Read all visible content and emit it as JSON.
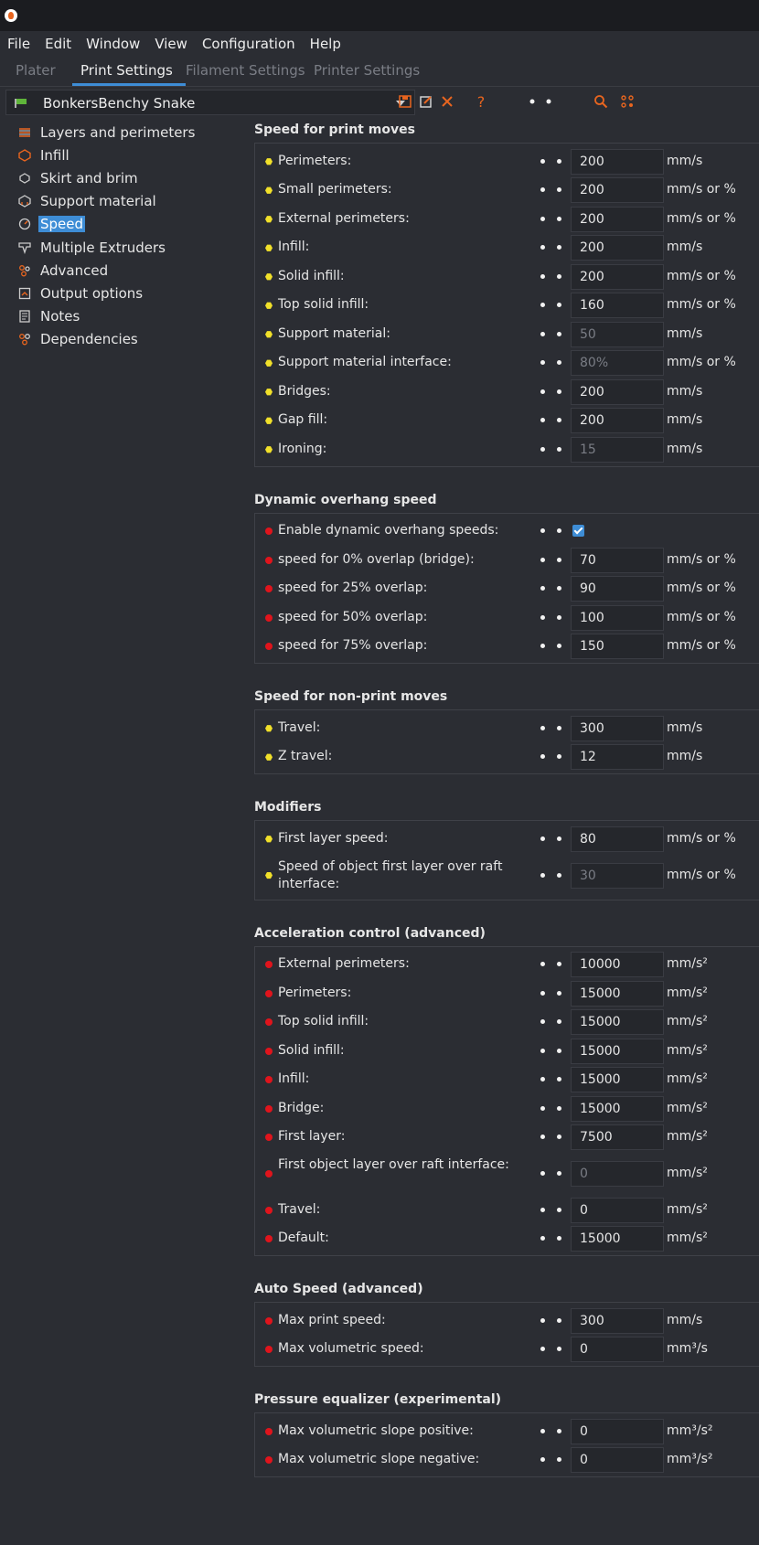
{
  "menu": [
    "File",
    "Edit",
    "Window",
    "View",
    "Configuration",
    "Help"
  ],
  "tabs": [
    "Plater",
    "Print Settings",
    "Filament Settings",
    "Printer Settings"
  ],
  "preset": {
    "name": "BonkersBenchy Snake"
  },
  "toolbar_icons": [
    "save-icon",
    "edit-icon",
    "delete-icon",
    "help-icon",
    "compare-icon",
    "search-icon",
    "options-icon"
  ],
  "toolbar_glyphs": {
    "help": "?"
  },
  "sidebar": [
    {
      "label": "Layers and perimeters",
      "icon": "layers-icon"
    },
    {
      "label": "Infill",
      "icon": "infill-icon"
    },
    {
      "label": "Skirt and brim",
      "icon": "skirt-icon"
    },
    {
      "label": "Support material",
      "icon": "support-icon"
    },
    {
      "label": "Speed",
      "icon": "speed-icon",
      "active": true
    },
    {
      "label": "Multiple Extruders",
      "icon": "extruder-icon"
    },
    {
      "label": "Advanced",
      "icon": "advanced-icon"
    },
    {
      "label": "Output options",
      "icon": "output-icon"
    },
    {
      "label": "Notes",
      "icon": "notes-icon"
    },
    {
      "label": "Dependencies",
      "icon": "dependencies-icon"
    }
  ],
  "colors": {
    "accent": "#3e8dd6",
    "bullet_yellow": "#f1e02a",
    "bullet_red": "#e0141c",
    "orange_icon": "#e8651f"
  },
  "sections": [
    {
      "title": "Speed for print moves",
      "rows": [
        {
          "label": "Perimeters:",
          "value": "200",
          "unit": "mm/s",
          "bullet": "yellow"
        },
        {
          "label": "Small perimeters:",
          "value": "200",
          "unit": "mm/s or %",
          "bullet": "yellow"
        },
        {
          "label": "External perimeters:",
          "value": "200",
          "unit": "mm/s or %",
          "bullet": "yellow"
        },
        {
          "label": "Infill:",
          "value": "200",
          "unit": "mm/s",
          "bullet": "yellow"
        },
        {
          "label": "Solid infill:",
          "value": "200",
          "unit": "mm/s or %",
          "bullet": "yellow"
        },
        {
          "label": "Top solid infill:",
          "value": "160",
          "unit": "mm/s or %",
          "bullet": "yellow"
        },
        {
          "label": "Support material:",
          "value": "50",
          "unit": "mm/s",
          "bullet": "yellow",
          "disabled": true
        },
        {
          "label": "Support material interface:",
          "value": "80%",
          "unit": "mm/s or %",
          "bullet": "yellow",
          "disabled": true
        },
        {
          "label": "Bridges:",
          "value": "200",
          "unit": "mm/s",
          "bullet": "yellow"
        },
        {
          "label": "Gap fill:",
          "value": "200",
          "unit": "mm/s",
          "bullet": "yellow"
        },
        {
          "label": "Ironing:",
          "value": "15",
          "unit": "mm/s",
          "bullet": "yellow",
          "disabled": true
        }
      ]
    },
    {
      "title": "Dynamic overhang speed",
      "rows": [
        {
          "label": "Enable dynamic overhang speeds:",
          "checkbox": true,
          "checked": true,
          "bullet": "red"
        },
        {
          "label": "speed for 0% overlap (bridge):",
          "value": "70",
          "unit": "mm/s or %",
          "bullet": "red"
        },
        {
          "label": "speed for 25% overlap:",
          "value": "90",
          "unit": "mm/s or %",
          "bullet": "red"
        },
        {
          "label": "speed for 50% overlap:",
          "value": "100",
          "unit": "mm/s or %",
          "bullet": "red"
        },
        {
          "label": "speed for 75% overlap:",
          "value": "150",
          "unit": "mm/s or %",
          "bullet": "red"
        }
      ]
    },
    {
      "title": "Speed for non-print moves",
      "rows": [
        {
          "label": "Travel:",
          "value": "300",
          "unit": "mm/s",
          "bullet": "yellow"
        },
        {
          "label": "Z travel:",
          "value": "12",
          "unit": "mm/s",
          "bullet": "yellow"
        }
      ]
    },
    {
      "title": "Modifiers",
      "rows": [
        {
          "label": "First layer speed:",
          "value": "80",
          "unit": "mm/s or %",
          "bullet": "yellow"
        },
        {
          "label": "Speed of object first layer over raft interface:",
          "value": "30",
          "unit": "mm/s or %",
          "bullet": "yellow",
          "disabled": true,
          "tall": true
        }
      ]
    },
    {
      "title": "Acceleration control (advanced)",
      "rows": [
        {
          "label": "External perimeters:",
          "value": "10000",
          "unit": "mm/s²",
          "bullet": "red"
        },
        {
          "label": "Perimeters:",
          "value": "15000",
          "unit": "mm/s²",
          "bullet": "red"
        },
        {
          "label": "Top solid infill:",
          "value": "15000",
          "unit": "mm/s²",
          "bullet": "red"
        },
        {
          "label": "Solid infill:",
          "value": "15000",
          "unit": "mm/s²",
          "bullet": "red"
        },
        {
          "label": "Infill:",
          "value": "15000",
          "unit": "mm/s²",
          "bullet": "red"
        },
        {
          "label": "Bridge:",
          "value": "15000",
          "unit": "mm/s²",
          "bullet": "red"
        },
        {
          "label": "First layer:",
          "value": "7500",
          "unit": "mm/s²",
          "bullet": "red"
        },
        {
          "label": "First object layer over raft interface:",
          "value": "0",
          "unit": "mm/s²",
          "bullet": "red",
          "disabled": true,
          "tall": true
        },
        {
          "label": "Travel:",
          "value": "0",
          "unit": "mm/s²",
          "bullet": "red"
        },
        {
          "label": "Default:",
          "value": "15000",
          "unit": "mm/s²",
          "bullet": "red"
        }
      ]
    },
    {
      "title": "Auto Speed (advanced)",
      "rows": [
        {
          "label": "Max print speed:",
          "value": "300",
          "unit": "mm/s",
          "bullet": "red"
        },
        {
          "label": "Max volumetric speed:",
          "value": "0",
          "unit": "mm³/s",
          "bullet": "red"
        }
      ]
    },
    {
      "title": "Pressure equalizer (experimental)",
      "rows": [
        {
          "label": "Max volumetric slope positive:",
          "value": "0",
          "unit": "mm³/s²",
          "bullet": "red"
        },
        {
          "label": "Max volumetric slope negative:",
          "value": "0",
          "unit": "mm³/s²",
          "bullet": "red"
        }
      ]
    }
  ]
}
